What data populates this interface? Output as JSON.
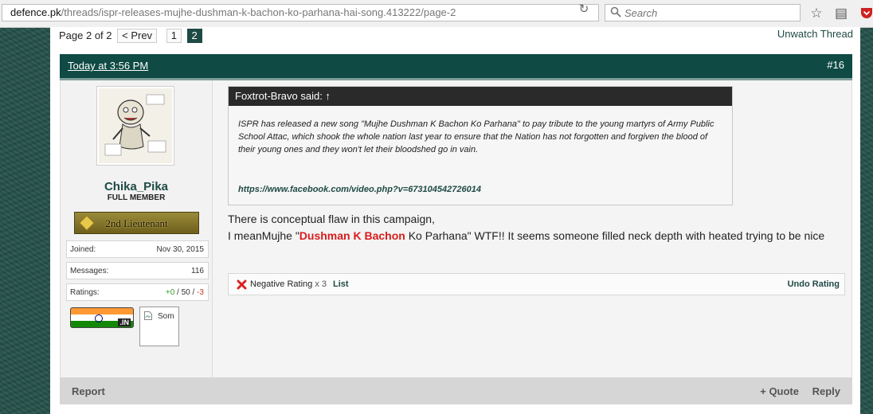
{
  "browser": {
    "url_host": "defence.pk",
    "url_path": "/threads/ispr-releases-mujhe-dushman-k-bachon-ko-parhana-hai-song.413222/page-2",
    "search_placeholder": "Search"
  },
  "pagination": {
    "label": "Page 2 of 2",
    "prev": "< Prev",
    "pages": [
      "1",
      "2"
    ],
    "current": "2"
  },
  "unwatch": "Unwatch Thread",
  "post": {
    "date": "Today at 3:56 PM",
    "number": "#16",
    "user": {
      "name": "Chika_Pika",
      "title": "FULL MEMBER",
      "rank": "2nd Lieutenant",
      "stats": [
        {
          "key": "Joined:",
          "value": "Nov 30, 2015"
        },
        {
          "key": "Messages:",
          "value": "116"
        }
      ],
      "ratings_label": "Ratings:",
      "ratings_pos": "+0",
      "ratings_sep1": " / ",
      "ratings_mid": "50",
      "ratings_sep2": " / ",
      "ratings_neg": "-3",
      "flag_label": ".IN",
      "broken_image_text": "Som"
    },
    "quote": {
      "header": "Foxtrot-Bravo said: ↑",
      "text": "ISPR has released a new song \"Mujhe Dushman K Bachon Ko Parhana\" to pay tribute to the young martyrs of Army Public School Attac, which shook the whole nation last year to ensure that the Nation has not forgotten and forgiven the blood of their young ones and they won't let their bloodshed go in vain.",
      "link": "https://www.facebook.com/video.php?v=673104542726014"
    },
    "message": {
      "line1": "There is conceptual flaw in this campaign,",
      "line2_pre": "I meanMujhe \"",
      "line2_highlight": "Dushman K Bachon",
      "line2_post": " Ko Parhana\" WTF!! It seems someone filled neck depth with heated trying to be nice"
    },
    "rating": {
      "label": "Negative Rating",
      "count": "x 3",
      "list": "List",
      "undo": "Undo Rating"
    },
    "footer": {
      "report": "Report",
      "quote": "+ Quote",
      "reply": "Reply"
    }
  }
}
